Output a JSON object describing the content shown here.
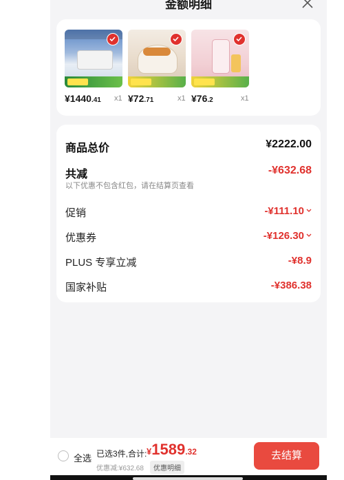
{
  "header": {
    "title": "金额明细"
  },
  "products": [
    {
      "price_int": "¥1440",
      "price_dec": ".41",
      "qty": "x1"
    },
    {
      "price_int": "¥72",
      "price_dec": ".71",
      "qty": "x1"
    },
    {
      "price_int": "¥76",
      "price_dec": ".2",
      "qty": "x1"
    }
  ],
  "summary": {
    "total_label": "商品总价",
    "total_value": "¥2222.00",
    "reduction_label": "共减",
    "reduction_value": "-¥632.68",
    "reduction_note": "以下优惠不包含红包，请在结算页查看",
    "items": [
      {
        "label": "促销",
        "value": "-¥111.10"
      },
      {
        "label": "优惠券",
        "value": "-¥126.30"
      },
      {
        "label": "PLUS 专享立减",
        "value": "-¥8.9"
      },
      {
        "label": "国家补贴",
        "value": "-¥386.38"
      }
    ]
  },
  "bottom": {
    "select_all": "全选",
    "count_label": "已选3件,合计:",
    "currency": "¥",
    "total_int": "1589",
    "total_dec": ".32",
    "discount": "优惠减:¥632.68",
    "detail_button": "优惠明细",
    "pay_button": "去结算"
  },
  "colors": {
    "accent": "#e0312d",
    "pay_button": "#e94a3f"
  },
  "icons": [
    "close-icon",
    "check-icon",
    "chevron-down-icon",
    "radio-icon"
  ]
}
